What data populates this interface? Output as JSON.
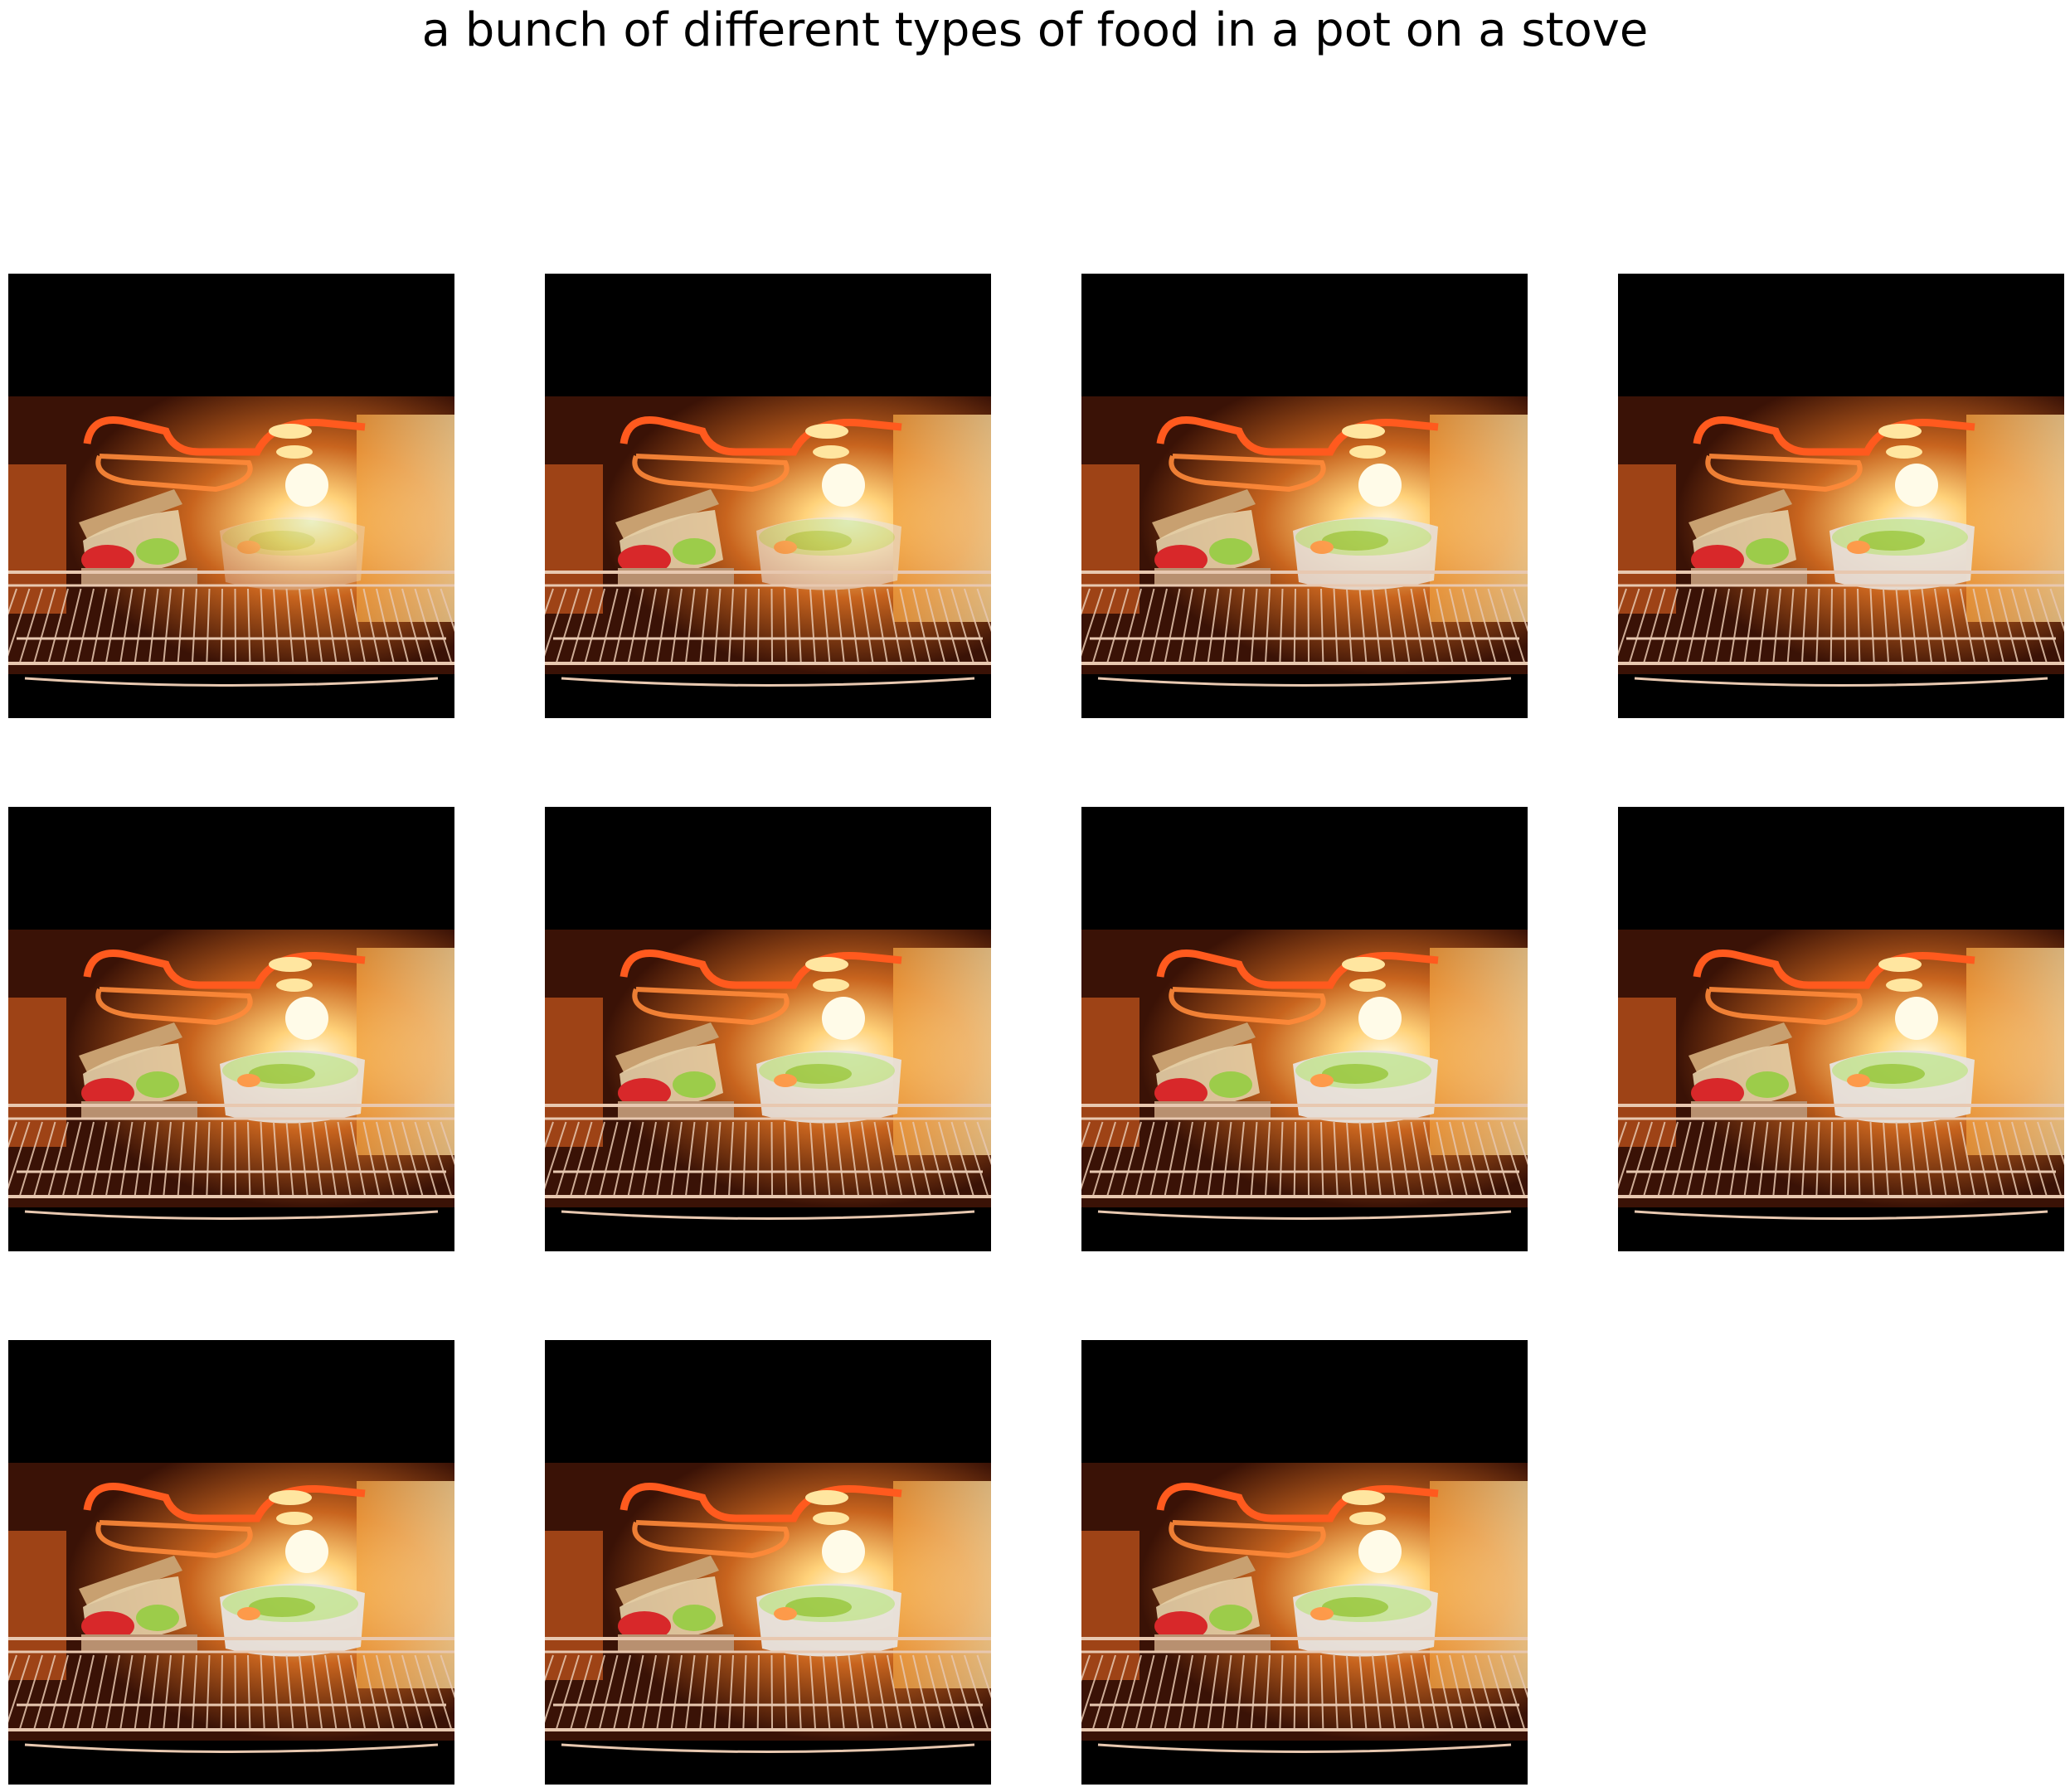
{
  "figure": {
    "title": "a bunch of different types of food in a pot on a stove"
  },
  "grid": {
    "columns": 4,
    "rows": 3,
    "frames": [
      {
        "subject": "oven-with-sandwich-and-pot",
        "pot_visibility": 0.35
      },
      {
        "subject": "oven-with-sandwich-and-pot",
        "pot_visibility": 0.6
      },
      {
        "subject": "oven-with-sandwich-and-pot",
        "pot_visibility": 0.85
      },
      {
        "subject": "oven-with-sandwich-and-pot",
        "pot_visibility": 0.9
      },
      {
        "subject": "oven-with-sandwich-and-pot",
        "pot_visibility": 0.9
      },
      {
        "subject": "oven-with-sandwich-and-pot",
        "pot_visibility": 0.9
      },
      {
        "subject": "oven-with-sandwich-and-pot",
        "pot_visibility": 0.95
      },
      {
        "subject": "oven-with-sandwich-and-pot",
        "pot_visibility": 0.95
      },
      {
        "subject": "oven-with-sandwich-and-pot",
        "pot_visibility": 0.95
      },
      {
        "subject": "oven-with-sandwich-and-pot",
        "pot_visibility": 0.95
      },
      {
        "subject": "oven-with-sandwich-and-pot",
        "pot_visibility": 0.95
      }
    ]
  },
  "colors": {
    "background": "#ffffff",
    "oven_black": "#000000",
    "heating_element": "#ff5a1e",
    "glow": "#ffd27a",
    "oven_wall": "#b8501a",
    "rack": "#e8c8b0",
    "bread": "#c8a070",
    "tomato": "#d8282a",
    "lettuce": "#9ccc4a",
    "pot": "#e8e4e0"
  }
}
